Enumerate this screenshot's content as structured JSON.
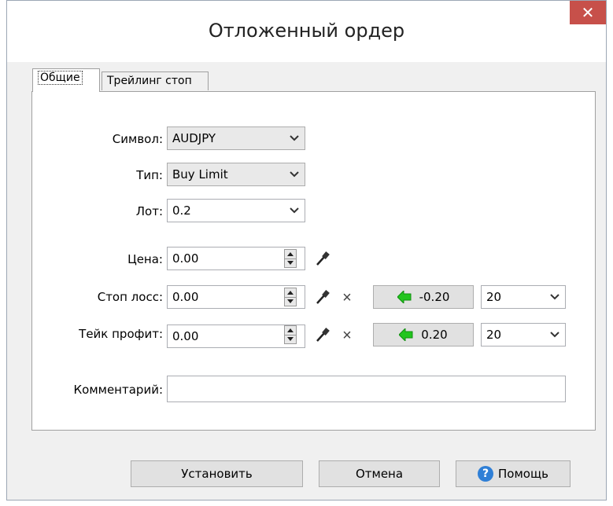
{
  "window": {
    "title": "Отложенный ордер",
    "close_glyph": "✕"
  },
  "tabs": [
    {
      "label": "Общие",
      "active": true
    },
    {
      "label": "Трейлинг стоп",
      "active": false
    }
  ],
  "form": {
    "symbol_label": "Символ:",
    "symbol_value": "AUDJPY",
    "type_label": "Тип:",
    "type_value": "Buy Limit",
    "lot_label": "Лот:",
    "lot_value": "0.2",
    "price_label": "Цена:",
    "price_value": "0.00",
    "stoploss_label": "Стоп лосс:",
    "stoploss_value": "0.00",
    "stoploss_clear": "×",
    "stoploss_btn": "-0.20",
    "stoploss_points": "20",
    "takeprofit_label": "Тейк профит:",
    "takeprofit_value": "0.00",
    "takeprofit_clear": "×",
    "takeprofit_btn": "0.20",
    "takeprofit_points": "20",
    "comment_label": "Комментарий:",
    "comment_value": ""
  },
  "buttons": {
    "place": "Установить",
    "cancel": "Отмена",
    "help": "Помощь",
    "help_glyph": "?"
  },
  "colors": {
    "close_bg": "#c7504a",
    "arrow_green": "#22c51e",
    "help_blue": "#2f7fd6"
  }
}
